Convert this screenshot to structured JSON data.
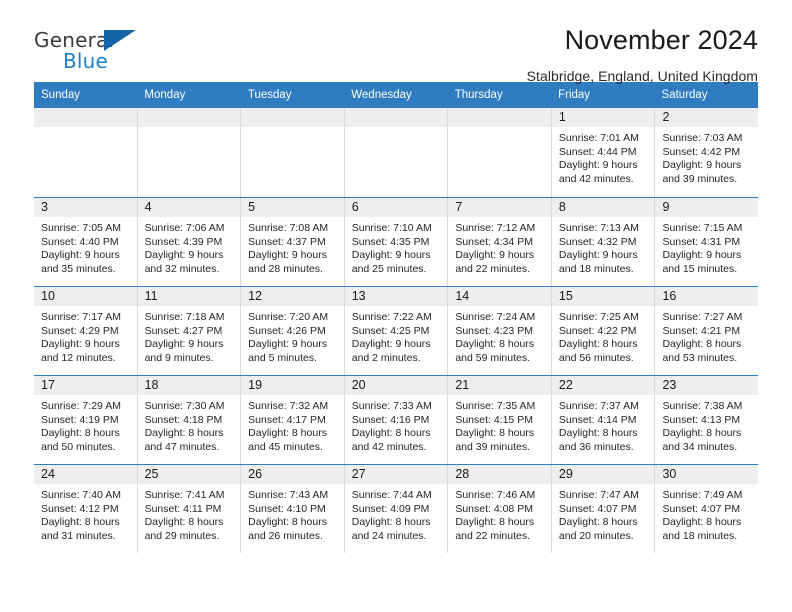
{
  "brand": {
    "name_part1": "General",
    "name_part2": "Blue",
    "triangle_color": "#1664a8",
    "blue_text_color": "#1e7fc4"
  },
  "header": {
    "title": "November 2024",
    "location": "Stalbridge, England, United Kingdom"
  },
  "theme": {
    "header_blue": "#2f7cc0",
    "daynum_bg": "#eeeeee",
    "cell_border": "#d9d9d9"
  },
  "weekdays": [
    "Sunday",
    "Monday",
    "Tuesday",
    "Wednesday",
    "Thursday",
    "Friday",
    "Saturday"
  ],
  "weeks": [
    [
      {
        "day": "",
        "sunrise": "",
        "sunset": "",
        "daylight1": "",
        "daylight2": ""
      },
      {
        "day": "",
        "sunrise": "",
        "sunset": "",
        "daylight1": "",
        "daylight2": ""
      },
      {
        "day": "",
        "sunrise": "",
        "sunset": "",
        "daylight1": "",
        "daylight2": ""
      },
      {
        "day": "",
        "sunrise": "",
        "sunset": "",
        "daylight1": "",
        "daylight2": ""
      },
      {
        "day": "",
        "sunrise": "",
        "sunset": "",
        "daylight1": "",
        "daylight2": ""
      },
      {
        "day": "1",
        "sunrise": "Sunrise: 7:01 AM",
        "sunset": "Sunset: 4:44 PM",
        "daylight1": "Daylight: 9 hours",
        "daylight2": "and 42 minutes."
      },
      {
        "day": "2",
        "sunrise": "Sunrise: 7:03 AM",
        "sunset": "Sunset: 4:42 PM",
        "daylight1": "Daylight: 9 hours",
        "daylight2": "and 39 minutes."
      }
    ],
    [
      {
        "day": "3",
        "sunrise": "Sunrise: 7:05 AM",
        "sunset": "Sunset: 4:40 PM",
        "daylight1": "Daylight: 9 hours",
        "daylight2": "and 35 minutes."
      },
      {
        "day": "4",
        "sunrise": "Sunrise: 7:06 AM",
        "sunset": "Sunset: 4:39 PM",
        "daylight1": "Daylight: 9 hours",
        "daylight2": "and 32 minutes."
      },
      {
        "day": "5",
        "sunrise": "Sunrise: 7:08 AM",
        "sunset": "Sunset: 4:37 PM",
        "daylight1": "Daylight: 9 hours",
        "daylight2": "and 28 minutes."
      },
      {
        "day": "6",
        "sunrise": "Sunrise: 7:10 AM",
        "sunset": "Sunset: 4:35 PM",
        "daylight1": "Daylight: 9 hours",
        "daylight2": "and 25 minutes."
      },
      {
        "day": "7",
        "sunrise": "Sunrise: 7:12 AM",
        "sunset": "Sunset: 4:34 PM",
        "daylight1": "Daylight: 9 hours",
        "daylight2": "and 22 minutes."
      },
      {
        "day": "8",
        "sunrise": "Sunrise: 7:13 AM",
        "sunset": "Sunset: 4:32 PM",
        "daylight1": "Daylight: 9 hours",
        "daylight2": "and 18 minutes."
      },
      {
        "day": "9",
        "sunrise": "Sunrise: 7:15 AM",
        "sunset": "Sunset: 4:31 PM",
        "daylight1": "Daylight: 9 hours",
        "daylight2": "and 15 minutes."
      }
    ],
    [
      {
        "day": "10",
        "sunrise": "Sunrise: 7:17 AM",
        "sunset": "Sunset: 4:29 PM",
        "daylight1": "Daylight: 9 hours",
        "daylight2": "and 12 minutes."
      },
      {
        "day": "11",
        "sunrise": "Sunrise: 7:18 AM",
        "sunset": "Sunset: 4:27 PM",
        "daylight1": "Daylight: 9 hours",
        "daylight2": "and 9 minutes."
      },
      {
        "day": "12",
        "sunrise": "Sunrise: 7:20 AM",
        "sunset": "Sunset: 4:26 PM",
        "daylight1": "Daylight: 9 hours",
        "daylight2": "and 5 minutes."
      },
      {
        "day": "13",
        "sunrise": "Sunrise: 7:22 AM",
        "sunset": "Sunset: 4:25 PM",
        "daylight1": "Daylight: 9 hours",
        "daylight2": "and 2 minutes."
      },
      {
        "day": "14",
        "sunrise": "Sunrise: 7:24 AM",
        "sunset": "Sunset: 4:23 PM",
        "daylight1": "Daylight: 8 hours",
        "daylight2": "and 59 minutes."
      },
      {
        "day": "15",
        "sunrise": "Sunrise: 7:25 AM",
        "sunset": "Sunset: 4:22 PM",
        "daylight1": "Daylight: 8 hours",
        "daylight2": "and 56 minutes."
      },
      {
        "day": "16",
        "sunrise": "Sunrise: 7:27 AM",
        "sunset": "Sunset: 4:21 PM",
        "daylight1": "Daylight: 8 hours",
        "daylight2": "and 53 minutes."
      }
    ],
    [
      {
        "day": "17",
        "sunrise": "Sunrise: 7:29 AM",
        "sunset": "Sunset: 4:19 PM",
        "daylight1": "Daylight: 8 hours",
        "daylight2": "and 50 minutes."
      },
      {
        "day": "18",
        "sunrise": "Sunrise: 7:30 AM",
        "sunset": "Sunset: 4:18 PM",
        "daylight1": "Daylight: 8 hours",
        "daylight2": "and 47 minutes."
      },
      {
        "day": "19",
        "sunrise": "Sunrise: 7:32 AM",
        "sunset": "Sunset: 4:17 PM",
        "daylight1": "Daylight: 8 hours",
        "daylight2": "and 45 minutes."
      },
      {
        "day": "20",
        "sunrise": "Sunrise: 7:33 AM",
        "sunset": "Sunset: 4:16 PM",
        "daylight1": "Daylight: 8 hours",
        "daylight2": "and 42 minutes."
      },
      {
        "day": "21",
        "sunrise": "Sunrise: 7:35 AM",
        "sunset": "Sunset: 4:15 PM",
        "daylight1": "Daylight: 8 hours",
        "daylight2": "and 39 minutes."
      },
      {
        "day": "22",
        "sunrise": "Sunrise: 7:37 AM",
        "sunset": "Sunset: 4:14 PM",
        "daylight1": "Daylight: 8 hours",
        "daylight2": "and 36 minutes."
      },
      {
        "day": "23",
        "sunrise": "Sunrise: 7:38 AM",
        "sunset": "Sunset: 4:13 PM",
        "daylight1": "Daylight: 8 hours",
        "daylight2": "and 34 minutes."
      }
    ],
    [
      {
        "day": "24",
        "sunrise": "Sunrise: 7:40 AM",
        "sunset": "Sunset: 4:12 PM",
        "daylight1": "Daylight: 8 hours",
        "daylight2": "and 31 minutes."
      },
      {
        "day": "25",
        "sunrise": "Sunrise: 7:41 AM",
        "sunset": "Sunset: 4:11 PM",
        "daylight1": "Daylight: 8 hours",
        "daylight2": "and 29 minutes."
      },
      {
        "day": "26",
        "sunrise": "Sunrise: 7:43 AM",
        "sunset": "Sunset: 4:10 PM",
        "daylight1": "Daylight: 8 hours",
        "daylight2": "and 26 minutes."
      },
      {
        "day": "27",
        "sunrise": "Sunrise: 7:44 AM",
        "sunset": "Sunset: 4:09 PM",
        "daylight1": "Daylight: 8 hours",
        "daylight2": "and 24 minutes."
      },
      {
        "day": "28",
        "sunrise": "Sunrise: 7:46 AM",
        "sunset": "Sunset: 4:08 PM",
        "daylight1": "Daylight: 8 hours",
        "daylight2": "and 22 minutes."
      },
      {
        "day": "29",
        "sunrise": "Sunrise: 7:47 AM",
        "sunset": "Sunset: 4:07 PM",
        "daylight1": "Daylight: 8 hours",
        "daylight2": "and 20 minutes."
      },
      {
        "day": "30",
        "sunrise": "Sunrise: 7:49 AM",
        "sunset": "Sunset: 4:07 PM",
        "daylight1": "Daylight: 8 hours",
        "daylight2": "and 18 minutes."
      }
    ]
  ]
}
